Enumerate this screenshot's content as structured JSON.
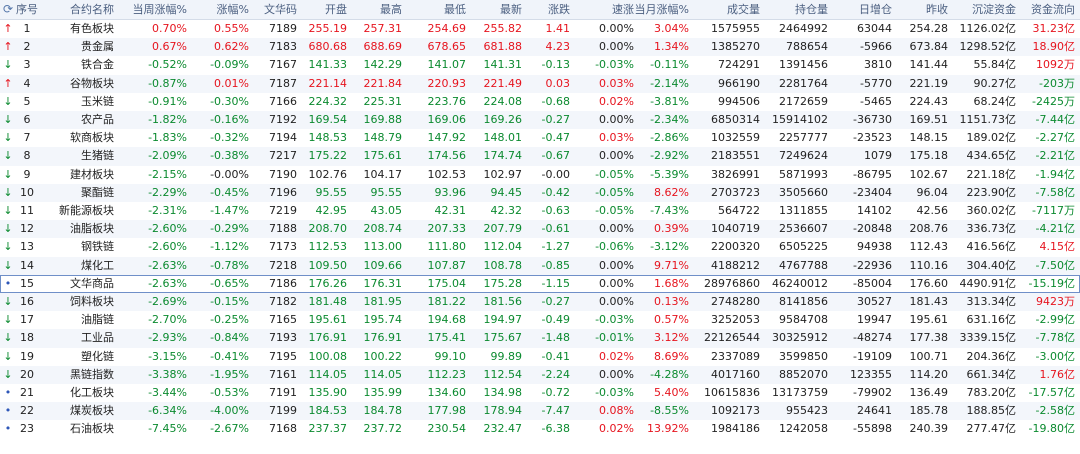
{
  "colors": {
    "up": "#e6141e",
    "down": "#0b8a2f",
    "flat": "#222222",
    "header_bg": "#f0f4fa"
  },
  "header": {
    "icon": "refresh-icon",
    "cols": [
      "序号",
      "合约名称",
      "当周涨幅%",
      "涨幅%",
      "文华码",
      "开盘",
      "最高",
      "最低",
      "最新",
      "涨跌",
      "速涨",
      "当月涨幅%",
      "成交量",
      "持仓量",
      "日增仓",
      "昨收",
      "沉淀资金",
      "资金流向"
    ]
  },
  "rows": [
    {
      "marker": "up",
      "no": "1",
      "name": "有色板块",
      "week": "0.70%",
      "chg": "0.55%",
      "code": "7189",
      "open": "255.19",
      "high": "257.31",
      "low": "254.69",
      "last": "255.82",
      "diff": "1.41",
      "speed": "0.00%",
      "month": "3.04%",
      "vol": "1575955",
      "oi": "2464992",
      "doi": "63044",
      "prev": "254.28",
      "cap": "1126.02亿",
      "flow": "31.23亿"
    },
    {
      "marker": "up",
      "no": "2",
      "name": "贵金属",
      "week": "0.67%",
      "chg": "0.62%",
      "code": "7183",
      "open": "680.68",
      "high": "688.69",
      "low": "678.65",
      "last": "681.88",
      "diff": "4.23",
      "speed": "0.00%",
      "month": "1.34%",
      "vol": "1385270",
      "oi": "788654",
      "doi": "-5966",
      "prev": "673.84",
      "cap": "1298.52亿",
      "flow": "18.90亿"
    },
    {
      "marker": "down",
      "no": "3",
      "name": "铁合金",
      "week": "-0.52%",
      "chg": "-0.09%",
      "code": "7167",
      "open": "141.33",
      "high": "142.29",
      "low": "141.07",
      "last": "141.31",
      "diff": "-0.13",
      "speed": "-0.03%",
      "month": "-0.11%",
      "vol": "724291",
      "oi": "1391456",
      "doi": "3810",
      "prev": "141.44",
      "cap": "55.84亿",
      "flow": "1092万"
    },
    {
      "marker": "up",
      "no": "4",
      "name": "谷物板块",
      "week": "-0.87%",
      "chg": "0.01%",
      "code": "7187",
      "open": "221.14",
      "high": "221.84",
      "low": "220.93",
      "last": "221.49",
      "diff": "0.03",
      "speed": "0.03%",
      "month": "-2.14%",
      "vol": "966190",
      "oi": "2281764",
      "doi": "-5770",
      "prev": "221.19",
      "cap": "90.27亿",
      "flow": "-203万"
    },
    {
      "marker": "down",
      "no": "5",
      "name": "玉米链",
      "week": "-0.91%",
      "chg": "-0.30%",
      "code": "7166",
      "open": "224.32",
      "high": "225.31",
      "low": "223.76",
      "last": "224.08",
      "diff": "-0.68",
      "speed": "0.02%",
      "month": "-3.81%",
      "vol": "994506",
      "oi": "2172659",
      "doi": "-5465",
      "prev": "224.43",
      "cap": "68.24亿",
      "flow": "-2425万"
    },
    {
      "marker": "down",
      "no": "6",
      "name": "农产品",
      "week": "-1.82%",
      "chg": "-0.16%",
      "code": "7192",
      "open": "169.54",
      "high": "169.88",
      "low": "169.06",
      "last": "169.26",
      "diff": "-0.27",
      "speed": "0.00%",
      "month": "-2.34%",
      "vol": "6850314",
      "oi": "15914102",
      "doi": "-36730",
      "prev": "169.51",
      "cap": "1151.73亿",
      "flow": "-7.44亿"
    },
    {
      "marker": "down",
      "no": "7",
      "name": "软商板块",
      "week": "-1.83%",
      "chg": "-0.32%",
      "code": "7194",
      "open": "148.53",
      "high": "148.79",
      "low": "147.92",
      "last": "148.01",
      "diff": "-0.47",
      "speed": "0.03%",
      "month": "-2.86%",
      "vol": "1032559",
      "oi": "2257777",
      "doi": "-23523",
      "prev": "148.15",
      "cap": "189.02亿",
      "flow": "-2.27亿"
    },
    {
      "marker": "down",
      "no": "8",
      "name": "生猪链",
      "week": "-2.09%",
      "chg": "-0.38%",
      "code": "7217",
      "open": "175.22",
      "high": "175.61",
      "low": "174.56",
      "last": "174.74",
      "diff": "-0.67",
      "speed": "0.00%",
      "month": "-2.92%",
      "vol": "2183551",
      "oi": "7249624",
      "doi": "1079",
      "prev": "175.18",
      "cap": "434.65亿",
      "flow": "-2.21亿"
    },
    {
      "marker": "down",
      "no": "9",
      "name": "建材板块",
      "week": "-2.15%",
      "chg": "-0.00%",
      "code": "7190",
      "open": "102.76",
      "high": "104.17",
      "low": "102.53",
      "last": "102.97",
      "diff": "-0.00",
      "speed": "-0.05%",
      "month": "-5.39%",
      "vol": "3826991",
      "oi": "5871993",
      "doi": "-86795",
      "prev": "102.67",
      "cap": "221.18亿",
      "flow": "-1.94亿"
    },
    {
      "marker": "down",
      "no": "10",
      "name": "聚酯链",
      "week": "-2.29%",
      "chg": "-0.45%",
      "code": "7196",
      "open": "95.55",
      "high": "95.55",
      "low": "93.96",
      "last": "94.45",
      "diff": "-0.42",
      "speed": "-0.05%",
      "month": "8.62%",
      "vol": "2703723",
      "oi": "3505660",
      "doi": "-23404",
      "prev": "96.04",
      "cap": "223.90亿",
      "flow": "-7.58亿"
    },
    {
      "marker": "down",
      "no": "11",
      "name": "新能源板块",
      "week": "-2.31%",
      "chg": "-1.47%",
      "code": "7219",
      "open": "42.95",
      "high": "43.05",
      "low": "42.31",
      "last": "42.32",
      "diff": "-0.63",
      "speed": "-0.05%",
      "month": "-7.43%",
      "vol": "564722",
      "oi": "1311855",
      "doi": "14102",
      "prev": "42.56",
      "cap": "360.02亿",
      "flow": "-7117万"
    },
    {
      "marker": "down",
      "no": "12",
      "name": "油脂板块",
      "week": "-2.60%",
      "chg": "-0.29%",
      "code": "7188",
      "open": "208.70",
      "high": "208.74",
      "low": "207.33",
      "last": "207.79",
      "diff": "-0.61",
      "speed": "0.00%",
      "month": "0.39%",
      "vol": "1040719",
      "oi": "2536607",
      "doi": "-20848",
      "prev": "208.76",
      "cap": "336.73亿",
      "flow": "-4.21亿"
    },
    {
      "marker": "down",
      "no": "13",
      "name": "钢铁链",
      "week": "-2.60%",
      "chg": "-1.12%",
      "code": "7173",
      "open": "112.53",
      "high": "113.00",
      "low": "111.80",
      "last": "112.04",
      "diff": "-1.27",
      "speed": "-0.06%",
      "month": "-3.12%",
      "vol": "2200320",
      "oi": "6505225",
      "doi": "94938",
      "prev": "112.43",
      "cap": "416.56亿",
      "flow": "4.15亿"
    },
    {
      "marker": "down",
      "no": "14",
      "name": "煤化工",
      "week": "-2.63%",
      "chg": "-0.78%",
      "code": "7218",
      "open": "109.50",
      "high": "109.66",
      "low": "107.87",
      "last": "108.78",
      "diff": "-0.85",
      "speed": "0.00%",
      "month": "9.71%",
      "vol": "4188212",
      "oi": "4767788",
      "doi": "-22936",
      "prev": "110.16",
      "cap": "304.40亿",
      "flow": "-7.50亿"
    },
    {
      "marker": "dot",
      "no": "15",
      "name": "文华商品",
      "week": "-2.63%",
      "chg": "-0.65%",
      "code": "7186",
      "open": "176.26",
      "high": "176.31",
      "low": "175.04",
      "last": "175.28",
      "diff": "-1.15",
      "speed": "0.00%",
      "month": "1.68%",
      "vol": "28976860",
      "oi": "46240012",
      "doi": "-85004",
      "prev": "176.60",
      "cap": "4490.91亿",
      "flow": "-15.19亿"
    },
    {
      "marker": "down",
      "no": "16",
      "name": "饲料板块",
      "week": "-2.69%",
      "chg": "-0.15%",
      "code": "7182",
      "open": "181.48",
      "high": "181.95",
      "low": "181.22",
      "last": "181.56",
      "diff": "-0.27",
      "speed": "0.00%",
      "month": "0.13%",
      "vol": "2748280",
      "oi": "8141856",
      "doi": "30527",
      "prev": "181.43",
      "cap": "313.34亿",
      "flow": "9423万"
    },
    {
      "marker": "down",
      "no": "17",
      "name": "油脂链",
      "week": "-2.70%",
      "chg": "-0.25%",
      "code": "7165",
      "open": "195.61",
      "high": "195.74",
      "low": "194.68",
      "last": "194.97",
      "diff": "-0.49",
      "speed": "-0.03%",
      "month": "0.57%",
      "vol": "3252053",
      "oi": "9584708",
      "doi": "19947",
      "prev": "195.61",
      "cap": "631.16亿",
      "flow": "-2.99亿"
    },
    {
      "marker": "down",
      "no": "18",
      "name": "工业品",
      "week": "-2.93%",
      "chg": "-0.84%",
      "code": "7193",
      "open": "176.91",
      "high": "176.91",
      "low": "175.41",
      "last": "175.67",
      "diff": "-1.48",
      "speed": "-0.01%",
      "month": "3.12%",
      "vol": "22126544",
      "oi": "30325912",
      "doi": "-48274",
      "prev": "177.38",
      "cap": "3339.15亿",
      "flow": "-7.78亿"
    },
    {
      "marker": "down",
      "no": "19",
      "name": "塑化链",
      "week": "-3.15%",
      "chg": "-0.41%",
      "code": "7195",
      "open": "100.08",
      "high": "100.22",
      "low": "99.10",
      "last": "99.89",
      "diff": "-0.41",
      "speed": "0.02%",
      "month": "8.69%",
      "vol": "2337089",
      "oi": "3599850",
      "doi": "-19109",
      "prev": "100.71",
      "cap": "204.36亿",
      "flow": "-3.00亿"
    },
    {
      "marker": "down",
      "no": "20",
      "name": "黑链指数",
      "week": "-3.38%",
      "chg": "-1.95%",
      "code": "7161",
      "open": "114.05",
      "high": "114.05",
      "low": "112.23",
      "last": "112.54",
      "diff": "-2.24",
      "speed": "0.00%",
      "month": "-4.28%",
      "vol": "4017160",
      "oi": "8852070",
      "doi": "123355",
      "prev": "114.20",
      "cap": "661.34亿",
      "flow": "1.76亿"
    },
    {
      "marker": "dot",
      "no": "21",
      "name": "化工板块",
      "week": "-3.44%",
      "chg": "-0.53%",
      "code": "7191",
      "open": "135.90",
      "high": "135.99",
      "low": "134.60",
      "last": "134.98",
      "diff": "-0.72",
      "speed": "-0.03%",
      "month": "5.40%",
      "vol": "10615836",
      "oi": "13173759",
      "doi": "-79902",
      "prev": "136.49",
      "cap": "783.20亿",
      "flow": "-17.57亿"
    },
    {
      "marker": "dot",
      "no": "22",
      "name": "煤炭板块",
      "week": "-6.34%",
      "chg": "-4.00%",
      "code": "7199",
      "open": "184.53",
      "high": "184.78",
      "low": "177.98",
      "last": "178.94",
      "diff": "-7.47",
      "speed": "0.08%",
      "month": "-8.55%",
      "vol": "1092173",
      "oi": "955423",
      "doi": "24641",
      "prev": "185.78",
      "cap": "188.85亿",
      "flow": "-2.58亿"
    },
    {
      "marker": "dot",
      "no": "23",
      "name": "石油板块",
      "week": "-7.45%",
      "chg": "-2.67%",
      "code": "7168",
      "open": "237.37",
      "high": "237.72",
      "low": "230.54",
      "last": "232.47",
      "diff": "-6.38",
      "speed": "0.02%",
      "month": "13.92%",
      "vol": "1984186",
      "oi": "1242058",
      "doi": "-55898",
      "prev": "240.39",
      "cap": "277.47亿",
      "flow": "-19.80亿"
    }
  ]
}
